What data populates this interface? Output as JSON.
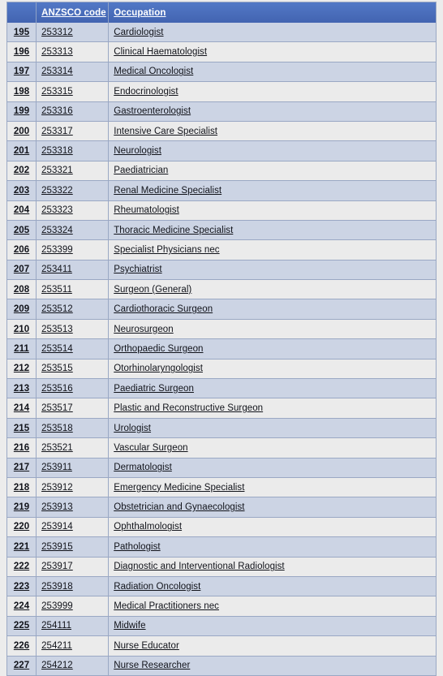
{
  "table": {
    "columns": [
      "",
      "ANZSCO code",
      "Occupation"
    ],
    "header": {
      "index_label": "",
      "code_label": "ANZSCO code",
      "occupation_label": "Occupation"
    },
    "colors": {
      "header_background": "#4a6fbd",
      "header_text": "#ffffff",
      "row_odd_background": "#ccd4e4",
      "row_even_background": "#ebebeb",
      "border": "#9aa8c4",
      "page_background": "#ececec",
      "cell_text": "#11131a"
    },
    "rows": [
      {
        "index": "195",
        "code": "253312",
        "occupation": "Cardiologist"
      },
      {
        "index": "196",
        "code": "253313",
        "occupation": "Clinical Haematologist"
      },
      {
        "index": "197",
        "code": "253314",
        "occupation": "Medical Oncologist"
      },
      {
        "index": "198",
        "code": "253315",
        "occupation": "Endocrinologist"
      },
      {
        "index": "199",
        "code": "253316",
        "occupation": "Gastroenterologist"
      },
      {
        "index": "200",
        "code": "253317",
        "occupation": "Intensive Care Specialist"
      },
      {
        "index": "201",
        "code": "253318",
        "occupation": "Neurologist"
      },
      {
        "index": "202",
        "code": "253321",
        "occupation": "Paediatrician"
      },
      {
        "index": "203",
        "code": "253322",
        "occupation": "Renal Medicine Specialist"
      },
      {
        "index": "204",
        "code": "253323",
        "occupation": "Rheumatologist"
      },
      {
        "index": "205",
        "code": "253324",
        "occupation": "Thoracic Medicine Specialist"
      },
      {
        "index": "206",
        "code": "253399",
        "occupation": "Specialist Physicians nec"
      },
      {
        "index": "207",
        "code": "253411",
        "occupation": "Psychiatrist"
      },
      {
        "index": "208",
        "code": "253511",
        "occupation": "Surgeon (General)"
      },
      {
        "index": "209",
        "code": "253512",
        "occupation": "Cardiothoracic Surgeon"
      },
      {
        "index": "210",
        "code": "253513",
        "occupation": "Neurosurgeon"
      },
      {
        "index": "211",
        "code": "253514",
        "occupation": "Orthopaedic Surgeon"
      },
      {
        "index": "212",
        "code": "253515",
        "occupation": "Otorhinolaryngologist"
      },
      {
        "index": "213",
        "code": "253516",
        "occupation": "Paediatric Surgeon"
      },
      {
        "index": "214",
        "code": "253517",
        "occupation": "Plastic and Reconstructive Surgeon"
      },
      {
        "index": "215",
        "code": "253518",
        "occupation": "Urologist"
      },
      {
        "index": "216",
        "code": "253521",
        "occupation": "Vascular Surgeon"
      },
      {
        "index": "217",
        "code": "253911",
        "occupation": "Dermatologist"
      },
      {
        "index": "218",
        "code": "253912",
        "occupation": "Emergency Medicine Specialist"
      },
      {
        "index": "219",
        "code": "253913",
        "occupation": "Obstetrician and Gynaecologist"
      },
      {
        "index": "220",
        "code": "253914",
        "occupation": "Ophthalmologist"
      },
      {
        "index": "221",
        "code": "253915",
        "occupation": "Pathologist"
      },
      {
        "index": "222",
        "code": "253917",
        "occupation": "Diagnostic and Interventional Radiologist"
      },
      {
        "index": "223",
        "code": "253918",
        "occupation": "Radiation Oncologist"
      },
      {
        "index": "224",
        "code": "253999",
        "occupation": "Medical Practitioners nec"
      },
      {
        "index": "225",
        "code": "254111",
        "occupation": "Midwife"
      },
      {
        "index": "226",
        "code": "254211",
        "occupation": "Nurse Educator"
      },
      {
        "index": "227",
        "code": "254212",
        "occupation": "Nurse Researcher"
      }
    ]
  }
}
